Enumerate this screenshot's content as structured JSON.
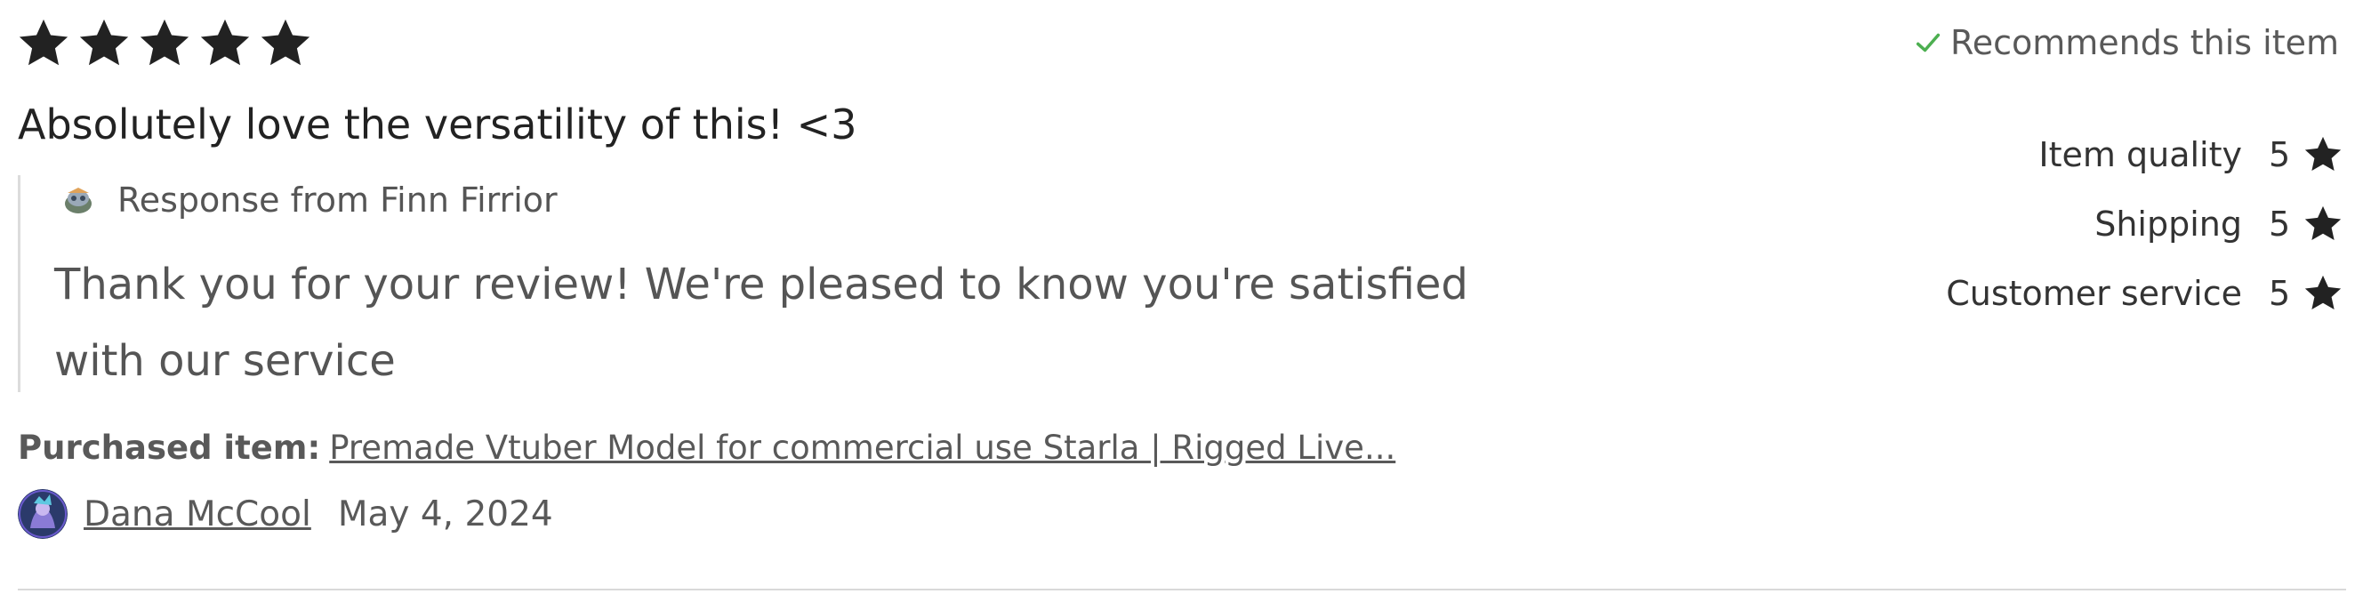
{
  "review": {
    "star_rating": 5,
    "text": "Absolutely love the versatility of this! <3",
    "recommends_label": "Recommends this item",
    "ratings": [
      {
        "label": "Item quality",
        "value": "5"
      },
      {
        "label": "Shipping",
        "value": "5"
      },
      {
        "label": "Customer service",
        "value": "5"
      }
    ],
    "response": {
      "from_label": "Response from Finn Firrior",
      "text": "Thank you for your review! We're pleased to know you're satisfied with our service"
    },
    "purchased": {
      "label": "Purchased item:",
      "item_link": "Premade Vtuber Model for commercial use Starla | Rigged Live..."
    },
    "author": {
      "name": "Dana McCool",
      "date": "May 4, 2024"
    }
  },
  "colors": {
    "star": "#222222",
    "check": "#4caf50",
    "muted_text": "#595959",
    "divider": "#d9d9d9"
  },
  "icons": {
    "star": "star-icon",
    "check": "check-icon",
    "shop_avatar": "shop-avatar-icon",
    "user_avatar": "user-avatar"
  }
}
